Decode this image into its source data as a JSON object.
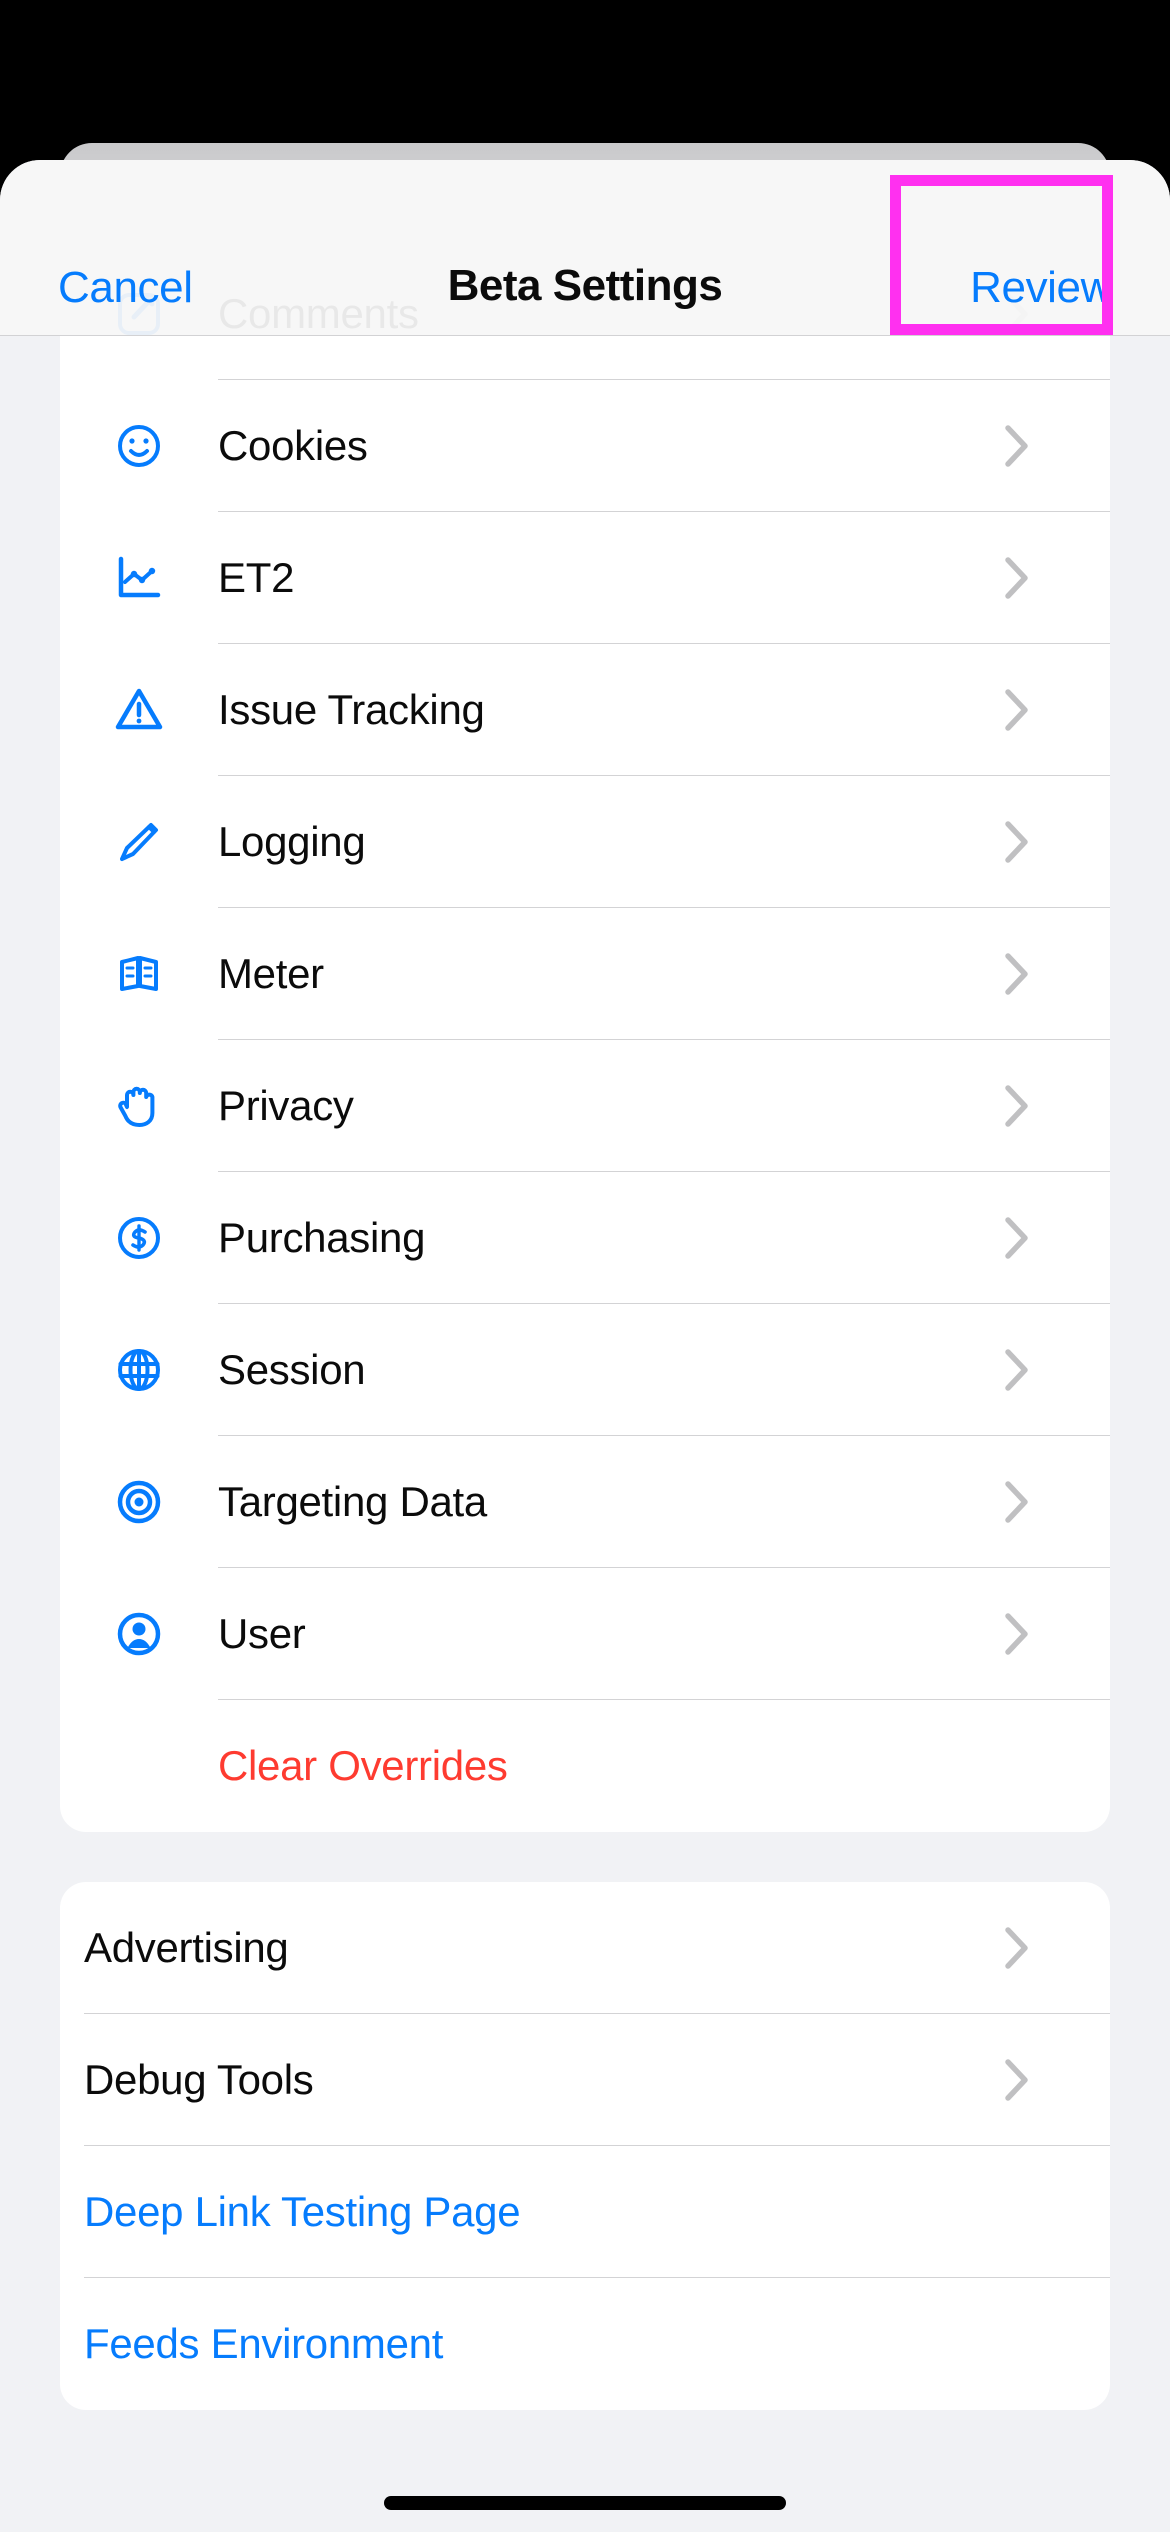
{
  "nav": {
    "cancel_label": "Cancel",
    "title": "Beta Settings",
    "review_label": "Review"
  },
  "colors": {
    "accent_blue": "#067cfd",
    "destructive_red": "#fe3b30",
    "highlight_magenta": "#ff30f0",
    "chevron_gray": "#c0c0c2",
    "page_background": "#f1f2f5",
    "card_background": "#ffffff"
  },
  "sections": [
    {
      "name": "beta-feature-sections",
      "rows": [
        {
          "label": "Comments",
          "icon": "compose-square-icon",
          "accessory": "chevron-right-icon",
          "style": "default"
        },
        {
          "label": "Cookies",
          "icon": "smiley-face-icon",
          "accessory": "chevron-right-icon",
          "style": "default"
        },
        {
          "label": "ET2",
          "icon": "line-chart-icon",
          "accessory": "chevron-right-icon",
          "style": "default"
        },
        {
          "label": "Issue Tracking",
          "icon": "warning-triangle-icon",
          "accessory": "chevron-right-icon",
          "style": "default"
        },
        {
          "label": "Logging",
          "icon": "pencil-icon",
          "accessory": "chevron-right-icon",
          "style": "default"
        },
        {
          "label": "Meter",
          "icon": "panels-icon",
          "accessory": "chevron-right-icon",
          "style": "default"
        },
        {
          "label": "Privacy",
          "icon": "raised-hand-icon",
          "accessory": "chevron-right-icon",
          "style": "default"
        },
        {
          "label": "Purchasing",
          "icon": "dollar-circle-icon",
          "accessory": "chevron-right-icon",
          "style": "default"
        },
        {
          "label": "Session",
          "icon": "globe-icon",
          "accessory": "chevron-right-icon",
          "style": "default"
        },
        {
          "label": "Targeting Data",
          "icon": "target-icon",
          "accessory": "chevron-right-icon",
          "style": "default"
        },
        {
          "label": "User",
          "icon": "person-circle-icon",
          "accessory": "chevron-right-icon",
          "style": "default"
        },
        {
          "label": "Clear Overrides",
          "icon": "none",
          "accessory": "none",
          "style": "destructive"
        }
      ]
    },
    {
      "name": "tools-section",
      "rows": [
        {
          "label": "Advertising",
          "icon": "none",
          "accessory": "chevron-right-icon",
          "style": "default"
        },
        {
          "label": "Debug Tools",
          "icon": "none",
          "accessory": "chevron-right-icon",
          "style": "default"
        },
        {
          "label": "Deep Link Testing Page",
          "icon": "none",
          "accessory": "none",
          "style": "link"
        },
        {
          "label": "Feeds Environment",
          "icon": "none",
          "accessory": "none",
          "style": "link"
        }
      ]
    }
  ]
}
